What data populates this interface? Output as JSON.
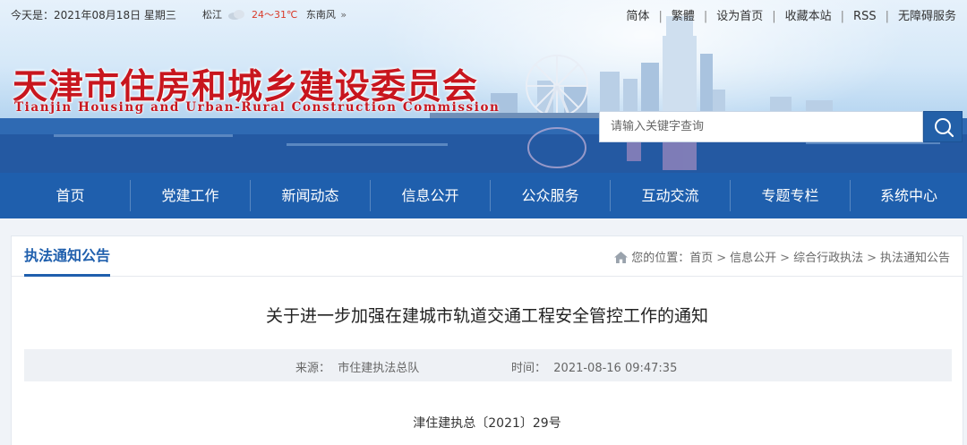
{
  "topbar": {
    "date": "今天是：2021年08月18日 星期三",
    "weather": {
      "city": "松江",
      "temp": "24～31℃",
      "wind": "东南风"
    },
    "links": [
      "简体",
      "繁體",
      "设为首页",
      "收藏本站",
      "RSS",
      "无障碍服务"
    ]
  },
  "logo": {
    "cn": "天津市住房和城乡建设委员会",
    "en": "Tianjin Housing and Urban-Rural Construction Commission"
  },
  "search": {
    "placeholder": "请输入关键字查询"
  },
  "nav": [
    "首页",
    "党建工作",
    "新闻动态",
    "信息公开",
    "公众服务",
    "互动交流",
    "专题专栏",
    "系统中心"
  ],
  "section": {
    "category": "执法通知公告",
    "breadcrumb": {
      "prefix": "您的位置：",
      "items": [
        "首页",
        "信息公开",
        "综合行政执法",
        "执法通知公告"
      ]
    }
  },
  "article": {
    "title": "关于进一步加强在建城市轨道交通工程安全管控工作的通知",
    "source_label": "来源：",
    "source": "市住建执法总队",
    "time_label": "时间：",
    "time": "2021-08-16 09:47:35",
    "doc_no": "津住建执总〔2021〕29号"
  },
  "colors": {
    "brand": "#1f5fad",
    "logo_red": "#c8161e",
    "temp_red": "#d93a2a"
  }
}
